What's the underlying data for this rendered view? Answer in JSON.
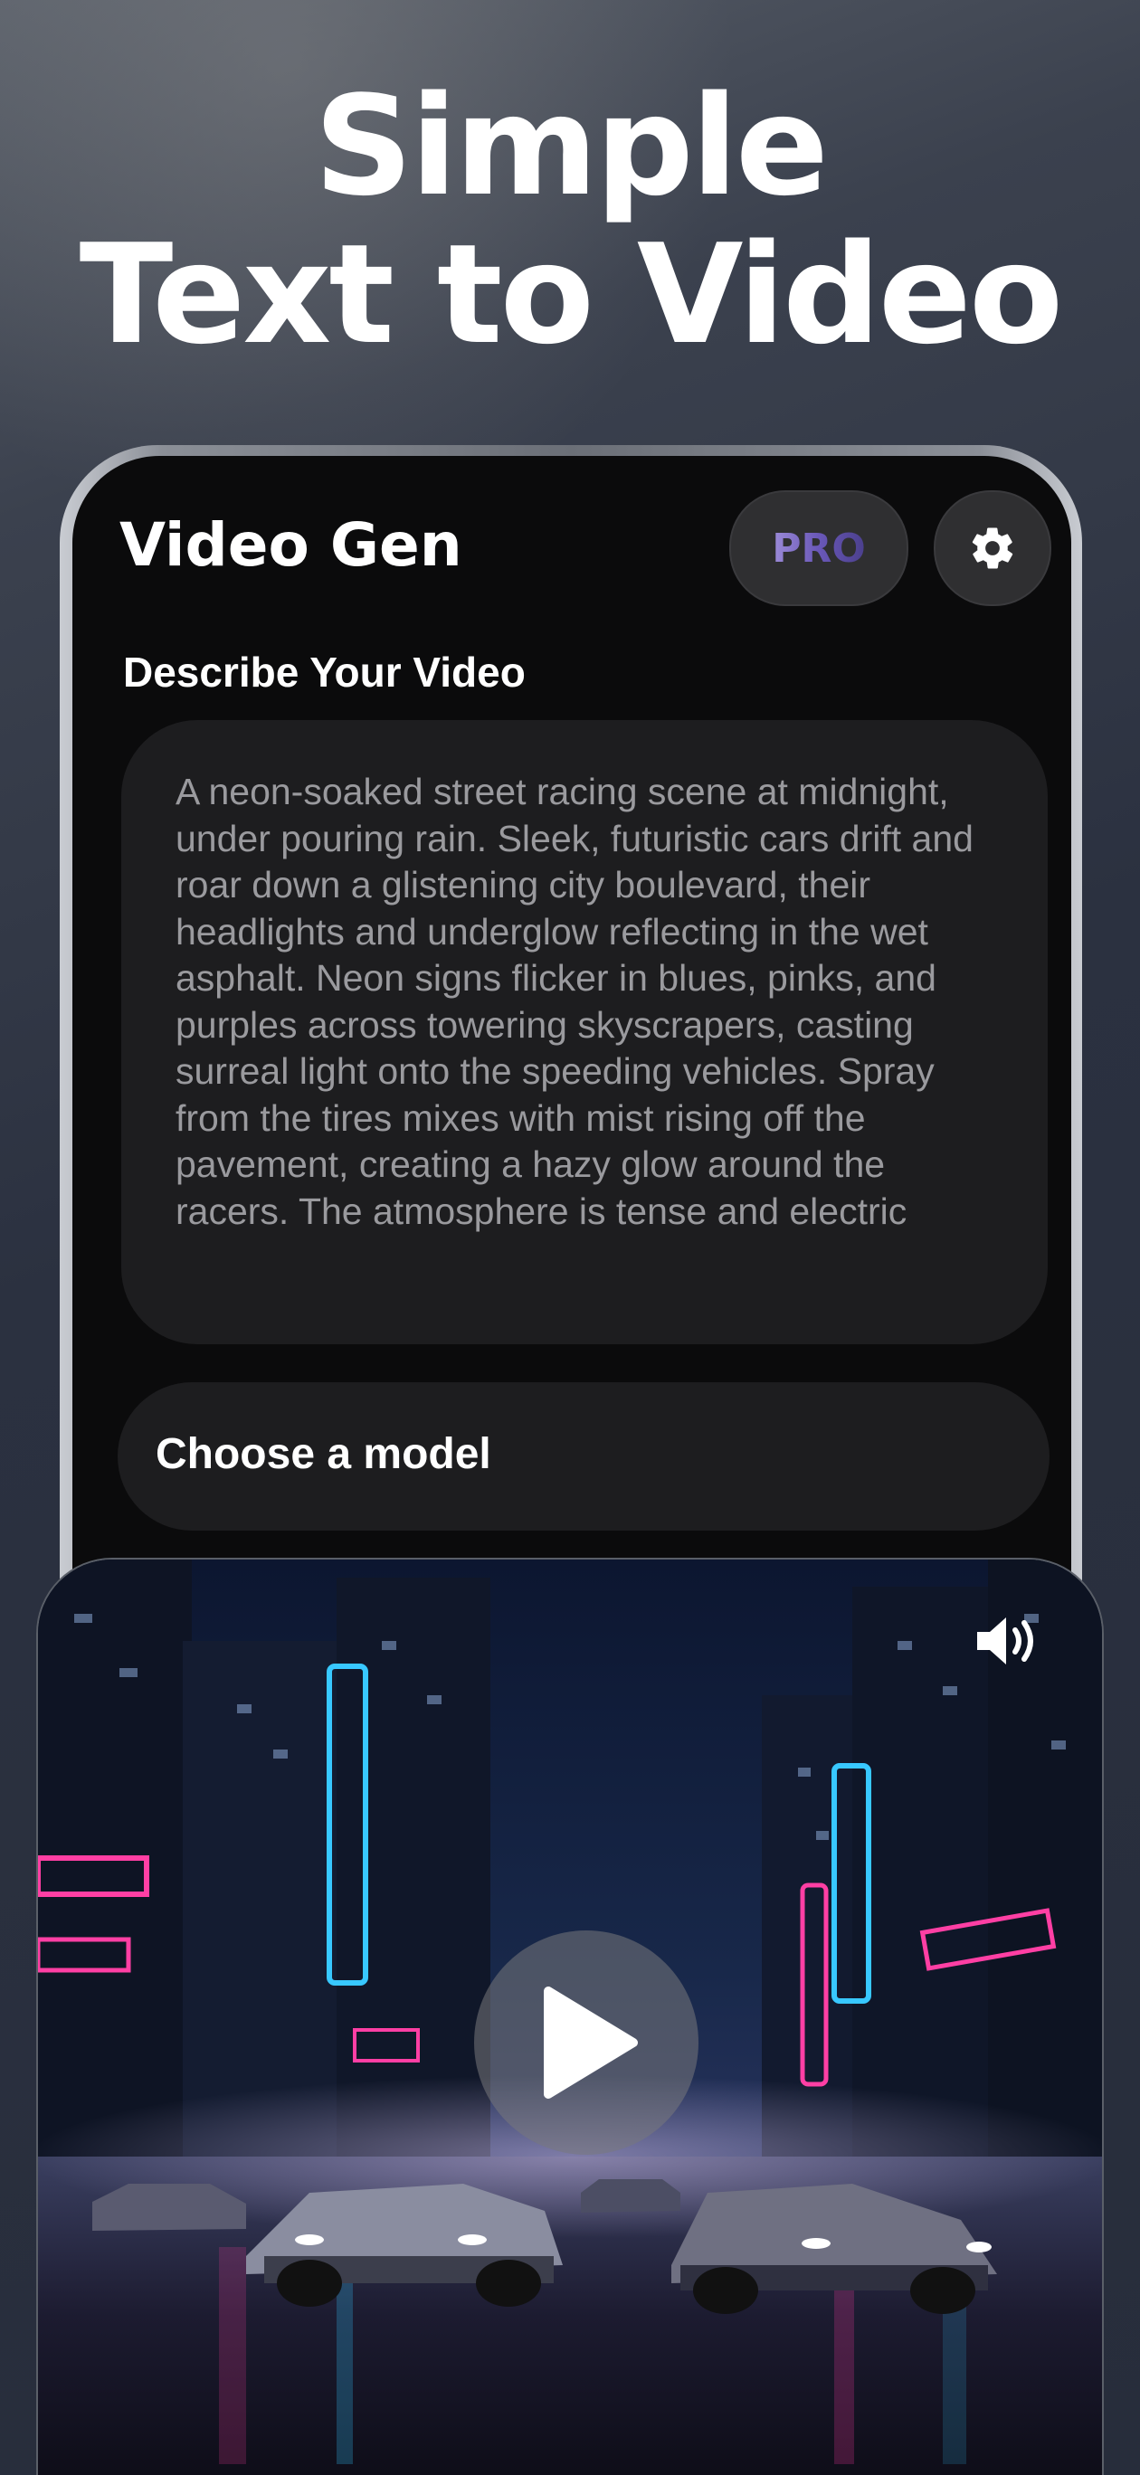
{
  "headline": {
    "line1": "Simple",
    "line2": "Text to Video"
  },
  "app": {
    "title": "Video Gen",
    "pro_label": "PRO",
    "settings_icon": "gear-icon"
  },
  "prompt": {
    "label": "Describe Your Video",
    "text": "A neon-soaked street racing scene at midnight, under pouring rain. Sleek, futuristic cars drift and roar down a glistening city boulevard, their headlights and underglow reflecting in the wet asphalt. Neon signs flicker in blues, pinks, and purples across towering skyscrapers, casting surreal light onto the speeding vehicles. Spray from the tires mixes with mist rising off the pavement, creating a hazy glow around the racers. The atmosphere is tense and electric"
  },
  "model": {
    "label": "Choose a model"
  },
  "video": {
    "sound_icon": "speaker-icon",
    "play_icon": "play-icon",
    "colors": {
      "neon_blue": "#38c8ff",
      "neon_pink": "#ff3fa4",
      "sky": "#0d1a33"
    }
  }
}
